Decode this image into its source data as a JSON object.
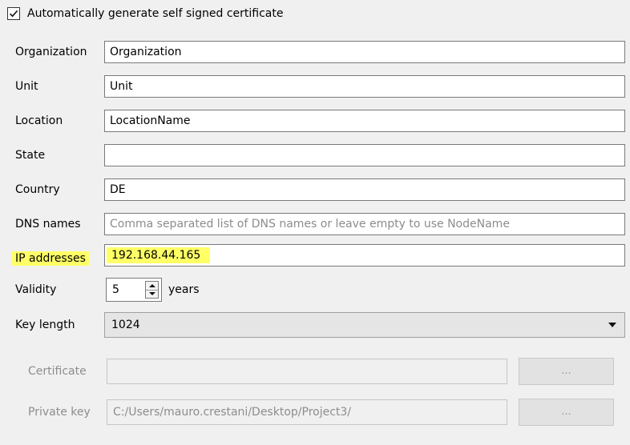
{
  "auto_cert": {
    "label": "Automatically generate self signed certificate",
    "checked": true
  },
  "fields": {
    "organization": {
      "label": "Organization",
      "value": "Organization"
    },
    "unit": {
      "label": "Unit",
      "value": "Unit"
    },
    "location": {
      "label": "Location",
      "value": "LocationName"
    },
    "state": {
      "label": "State",
      "value": ""
    },
    "country": {
      "label": "Country",
      "value": "DE"
    },
    "dns": {
      "label": "DNS names",
      "value": "",
      "placeholder": "Comma separated list of DNS names or leave empty to use NodeName"
    },
    "ip": {
      "label": "IP addresses",
      "value": "192.168.44.165",
      "highlight_color": "#ffff66"
    }
  },
  "validity": {
    "label": "Validity",
    "value": "5",
    "unit": "years"
  },
  "key_length": {
    "label": "Key length",
    "selected": "1024"
  },
  "certificate": {
    "label": "Certificate",
    "value": "",
    "button": "..."
  },
  "private_key": {
    "label": "Private key",
    "value": "C:/Users/mauro.crestani/Desktop/Project3/",
    "button": "..."
  }
}
